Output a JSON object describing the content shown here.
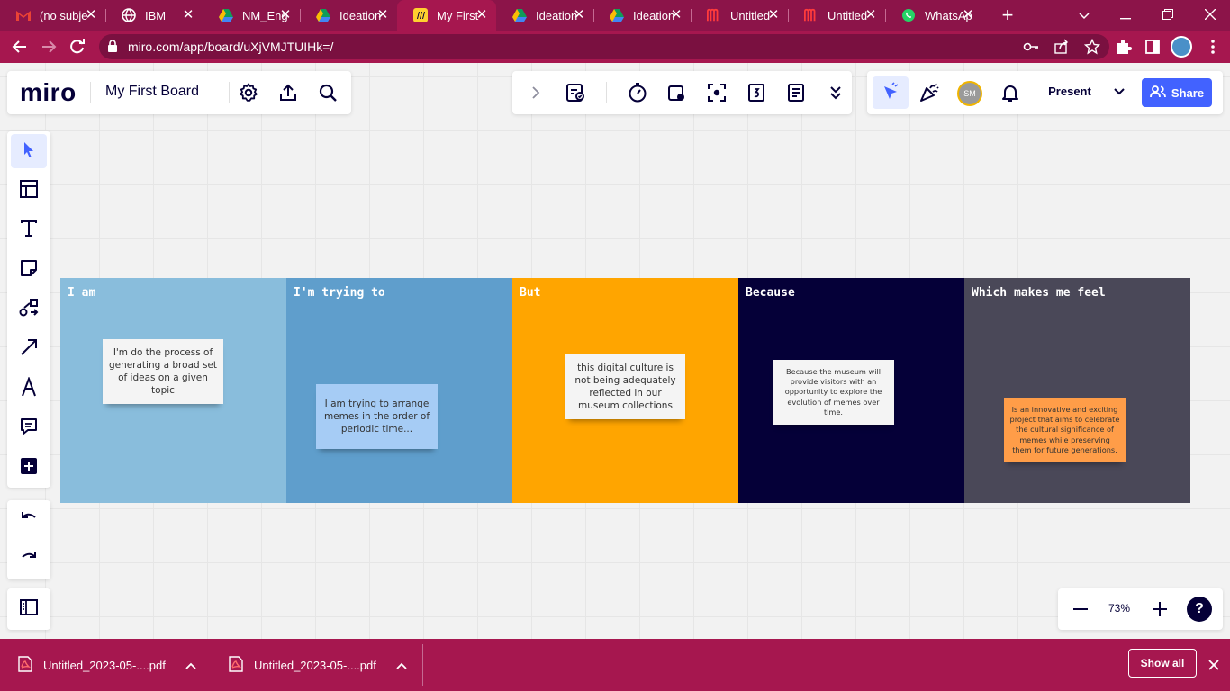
{
  "browser": {
    "tabs": [
      {
        "label": "(no subje",
        "icon": "gmail-icon"
      },
      {
        "label": "IBM",
        "icon": "globe-icon"
      },
      {
        "label": "NM_Eng",
        "icon": "drive-icon"
      },
      {
        "label": "Ideation",
        "icon": "drive-icon"
      },
      {
        "label": "My First",
        "icon": "miro-icon"
      },
      {
        "label": "Ideation",
        "icon": "drive-icon"
      },
      {
        "label": "Ideation",
        "icon": "drive-icon"
      },
      {
        "label": "Untitled",
        "icon": "miro-icon"
      },
      {
        "label": "Untitled",
        "icon": "miro-icon"
      },
      {
        "label": "WhatsAp",
        "icon": "whatsapp-icon"
      }
    ],
    "url": "miro.com/app/board/uXjVMJTUIHk=/",
    "colors": {
      "chrome": "#8c1449",
      "toolbar": "#a6174f"
    }
  },
  "miro": {
    "logo": "miro",
    "board_title": "My First Board",
    "present_label": "Present",
    "share_label": "Share",
    "avatar_initials": "SM",
    "zoom_level": "73%",
    "help_label": "?",
    "accent_color": "#4262ff"
  },
  "board": {
    "frames": [
      {
        "title": "I am",
        "bg": "#89bddc",
        "note": "I'm do the process of generating a broad set of ideas on a given topic",
        "note_bg": "#f4f4f4"
      },
      {
        "title": "I'm trying to",
        "bg": "#5f9ecc",
        "note": "I am  trying to arrange memes in the order of periodic time...",
        "note_bg": "#a6ccf5"
      },
      {
        "title": "But",
        "bg": "#ffa500",
        "note": "this digital culture is not being adequately reflected in our museum collections",
        "note_bg": "#f4f4f4"
      },
      {
        "title": "Because",
        "bg": "#050038",
        "note": "Because the museum will provide visitors with an opportunity to explore the evolution of memes over time.",
        "note_bg": "#f4f4f4"
      },
      {
        "title": "Which makes me feel",
        "bg": "#4a4858",
        "note": "Is an innovative and exciting project that aims to celebrate the cultural significance of memes while preserving them for future generations.",
        "note_bg": "#ff9d48"
      }
    ]
  },
  "downloads": {
    "items": [
      {
        "label": "Untitled_2023-05-....pdf"
      },
      {
        "label": "Untitled_2023-05-....pdf"
      }
    ],
    "show_all": "Show all"
  }
}
